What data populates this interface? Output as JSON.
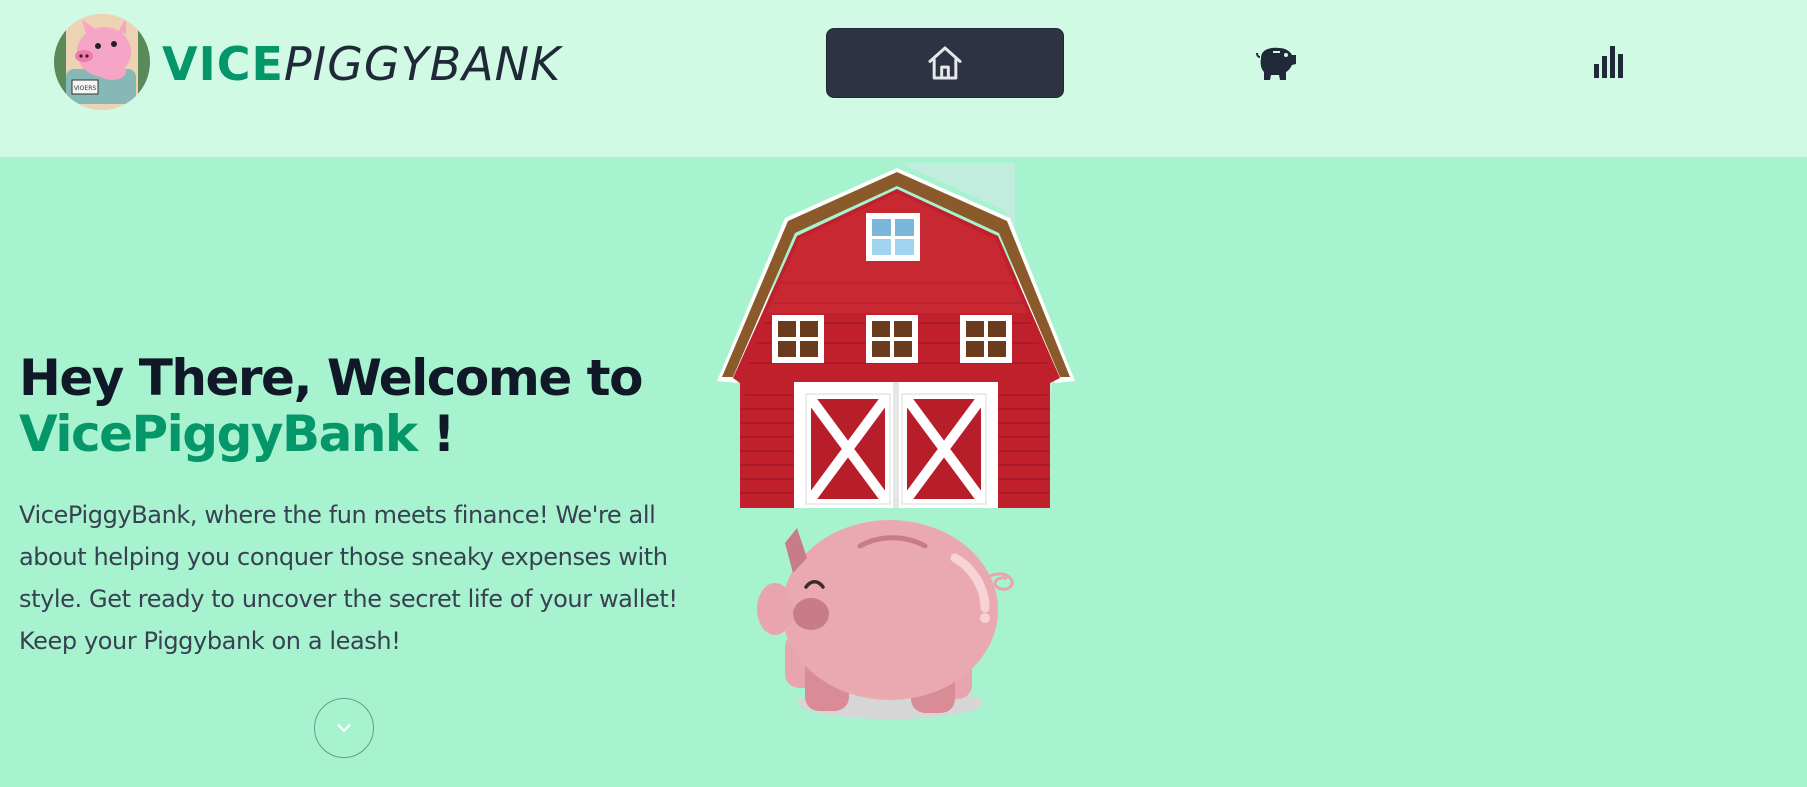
{
  "header": {
    "brand_bold": "VICE",
    "brand_italic": "PIGGYBANK",
    "logo_sign": "VIOERS",
    "nav": [
      {
        "name": "home",
        "icon": "home-icon",
        "active": true
      },
      {
        "name": "piggybank",
        "icon": "piggy-bank-icon",
        "active": false
      },
      {
        "name": "stats",
        "icon": "bar-chart-icon",
        "active": false
      }
    ]
  },
  "hero": {
    "title_line1": "Hey There, Welcome to",
    "title_brand": "VicePiggyBank",
    "title_suffix": " !",
    "description": "VicePiggyBank, where the fun meets finance! We're all about helping you conquer those sneaky expenses with style. Get ready to uncover the secret life of your wallet! Keep your Piggybank on a leash!",
    "scroll_icon": "chevron-down-icon",
    "illustration": "barn-and-piggy-bank"
  },
  "colors": {
    "header_bg": "#d1fae5",
    "page_bg": "#a7f3d0",
    "accent": "#059669",
    "dark": "#2d3342",
    "barn_red": "#b91c2a",
    "piggy_pink": "#e8a5ad"
  }
}
